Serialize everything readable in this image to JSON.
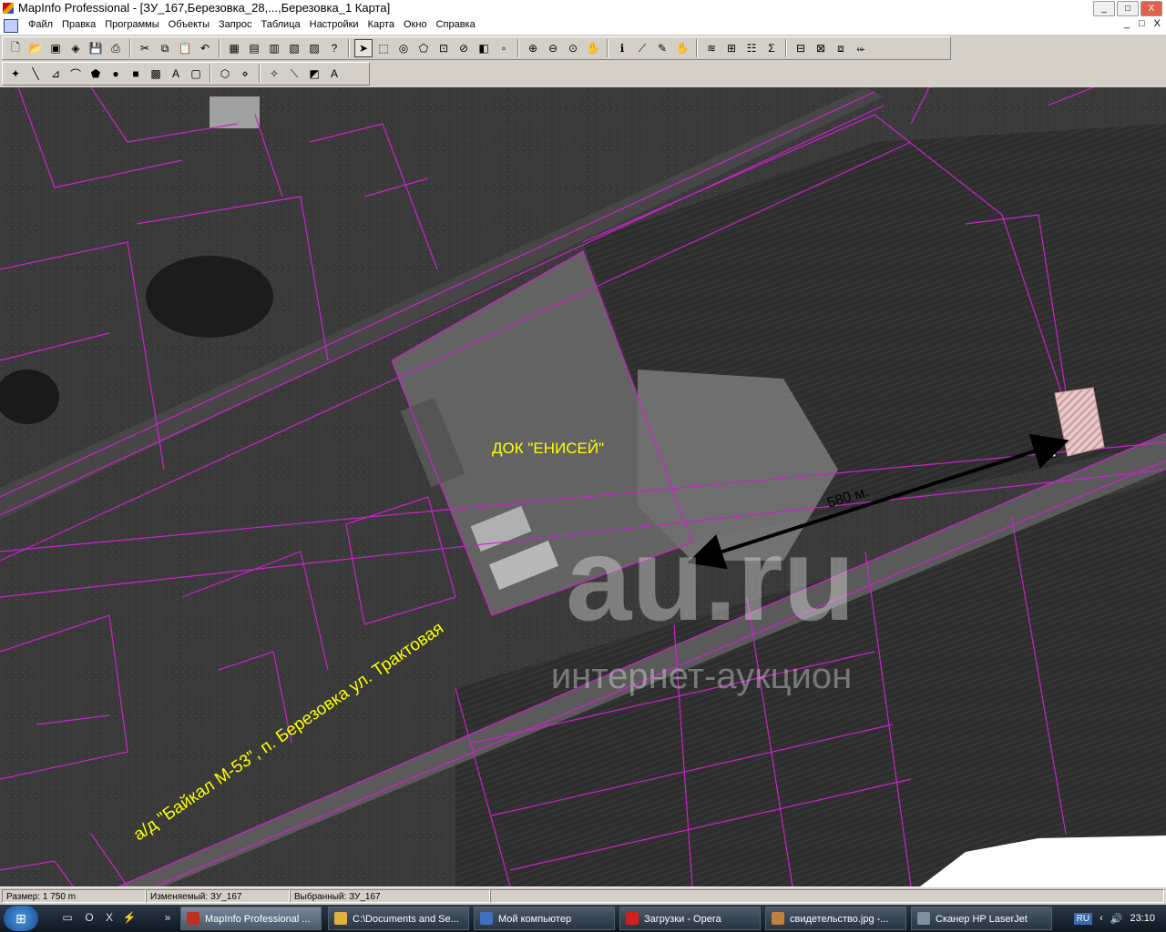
{
  "window": {
    "title": "MapInfo Professional - [ЗУ_167,Березовка_28,...,Березовка_1 Карта]",
    "buttons": [
      "_",
      "□",
      "X"
    ]
  },
  "menubar": {
    "items": [
      "Файл",
      "Правка",
      "Программы",
      "Объекты",
      "Запрос",
      "Таблица",
      "Настройки",
      "Карта",
      "Окно",
      "Справка"
    ],
    "mdi_buttons": [
      "_",
      "□",
      "X"
    ]
  },
  "toolbar_main": {
    "groups": [
      [
        "new-icon",
        "open-icon",
        "open-workspace-icon",
        "save-workspace-icon",
        "save-icon",
        "print-icon"
      ],
      [
        "cut-icon",
        "copy-icon",
        "paste-icon",
        "undo-icon"
      ],
      [
        "browser-icon",
        "new-map-icon",
        "graph-icon",
        "layout-icon",
        "redistrict-icon",
        "help-pointer-icon"
      ],
      [
        "select-icon",
        "marquee-select-icon",
        "radius-select-icon",
        "polygon-select-icon",
        "boundary-select-icon",
        "unselect-icon",
        "invert-select-icon",
        "graph-select-icon"
      ],
      [
        "zoom-in-icon",
        "zoom-out-icon",
        "change-view-icon",
        "grabber-icon"
      ],
      [
        "info-icon",
        "ruler-icon",
        "label-icon",
        "drag-window-icon"
      ],
      [
        "layer-control-icon",
        "ruler2-icon",
        "legend-icon",
        "stats-icon"
      ],
      [
        "add-theme-icon",
        "3d-map-icon",
        "prism-icon",
        "hotlink-icon"
      ]
    ],
    "glyphs": {
      "new-icon": "🗋",
      "open-icon": "📂",
      "open-workspace-icon": "▣",
      "save-workspace-icon": "◈",
      "save-icon": "💾",
      "print-icon": "⎙",
      "cut-icon": "✂",
      "copy-icon": "⧉",
      "paste-icon": "📋",
      "undo-icon": "↶",
      "browser-icon": "▦",
      "new-map-icon": "▤",
      "graph-icon": "▥",
      "layout-icon": "▧",
      "redistrict-icon": "▨",
      "help-pointer-icon": "?",
      "select-icon": "➤",
      "marquee-select-icon": "⬚",
      "radius-select-icon": "◎",
      "polygon-select-icon": "⬠",
      "boundary-select-icon": "⊡",
      "unselect-icon": "⊘",
      "invert-select-icon": "◧",
      "graph-select-icon": "▫",
      "zoom-in-icon": "⊕",
      "zoom-out-icon": "⊖",
      "change-view-icon": "⊙",
      "grabber-icon": "✋",
      "info-icon": "ℹ",
      "ruler-icon": "⟋",
      "label-icon": "✎",
      "drag-window-icon": "✋",
      "layer-control-icon": "≋",
      "ruler2-icon": "⊞",
      "legend-icon": "☷",
      "stats-icon": "Σ",
      "add-theme-icon": "⊟",
      "3d-map-icon": "⊠",
      "prism-icon": "⧈",
      "hotlink-icon": "⬰"
    },
    "active": "select-icon"
  },
  "toolbar_draw": {
    "tools": [
      "symbol-icon",
      "line-icon",
      "polyline-icon",
      "arc-icon",
      "polygon-icon",
      "ellipse-icon",
      "rectangle-icon",
      "rounded-rect-icon",
      "text-icon",
      "frame-icon",
      "reshape-icon",
      "add-node-icon",
      "symbol-style-icon",
      "line-style-icon",
      "region-style-icon",
      "text-style-icon"
    ],
    "glyphs": {
      "symbol-icon": "✦",
      "line-icon": "╲",
      "polyline-icon": "⊿",
      "arc-icon": "⌒",
      "polygon-icon": "⬟",
      "ellipse-icon": "●",
      "rectangle-icon": "■",
      "rounded-rect-icon": "▩",
      "text-icon": "A",
      "frame-icon": "▢",
      "reshape-icon": "⬡",
      "add-node-icon": "⋄",
      "symbol-style-icon": "✧",
      "line-style-icon": "⟍",
      "region-style-icon": "◩",
      "text-style-icon": "A"
    }
  },
  "map": {
    "labels": {
      "dock": "ДОК \"ЕНИСЕЙ\"",
      "distance": "580 м.",
      "road": "а/д \"Байкал М-53\", п. Березовка ул. Трактовая",
      "watermark_main": "au.ru",
      "watermark_sub": "интернет-аукцион"
    },
    "colors": {
      "parcel": "#cc22cc",
      "label": "#ffff00",
      "arrow": "#000000",
      "highlight": "#e8c8c8"
    }
  },
  "statusbar": {
    "size": "Размер: 1 750 m",
    "editable": "Изменяемый: ЗУ_167",
    "selected": "Выбранный: ЗУ_167"
  },
  "taskbar": {
    "tasks": [
      {
        "label": "MapInfo Professional ...",
        "color": "#c03020"
      },
      {
        "label": "C:\\Documents and Se...",
        "color": "#e0b040"
      },
      {
        "label": "Мой компьютер",
        "color": "#4070c0"
      },
      {
        "label": "Загрузки - Opera",
        "color": "#d02020"
      },
      {
        "label": "свидетельство.jpg -...",
        "color": "#c08040"
      },
      {
        "label": "Сканер HP LaserJet",
        "color": "#8090a0"
      }
    ],
    "lang": "RU",
    "clock": "23:10"
  }
}
